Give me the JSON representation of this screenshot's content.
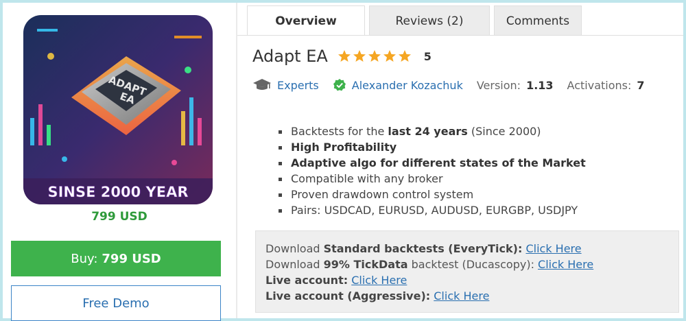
{
  "product": {
    "image_text_line1": "ADAPT",
    "image_text_line2": "EA",
    "image_banner": "SINSE 2000 YEAR",
    "price": "799 USD",
    "buy_label": "Buy:",
    "buy_price": "799 USD",
    "demo_label": "Free Demo"
  },
  "tabs": [
    {
      "label": "Overview",
      "active": true
    },
    {
      "label": "Reviews (2)",
      "active": false
    },
    {
      "label": "Comments",
      "active": false
    }
  ],
  "header": {
    "title": "Adapt EA",
    "stars": 5,
    "rating": "5",
    "star_color": "#f5a623"
  },
  "meta": {
    "category": "Experts",
    "author": "Alexander Kozachuk",
    "version_label": "Version:",
    "version_value": "1.13",
    "activations_label": "Activations:",
    "activations_value": "7"
  },
  "features": [
    {
      "pre": "Backtests for the ",
      "bold": "last 24 years",
      "post": " (Since 2000)"
    },
    {
      "pre": "",
      "bold": "High Profitability",
      "post": ""
    },
    {
      "pre": "",
      "bold": "Adaptive algo for different states of the Market",
      "post": ""
    },
    {
      "pre": "Compatible with any broker",
      "bold": "",
      "post": ""
    },
    {
      "pre": "Proven drawdown control system",
      "bold": "",
      "post": ""
    },
    {
      "pre": "Pairs: USDCAD, EURUSD, AUDUSD, EURGBP, USDJPY",
      "bold": "",
      "post": ""
    }
  ],
  "downloads": [
    {
      "pre": "Download ",
      "bold": "Standard backtests (EveryTick):",
      "mid": "",
      "link": "Click Here"
    },
    {
      "pre": "Download ",
      "bold": "99% TickData",
      "mid": " backtest (Ducascopy):",
      "link": "Click Here"
    },
    {
      "pre": "",
      "bold": "Live account:",
      "mid": "",
      "link": "Click Here"
    },
    {
      "pre": "",
      "bold": "Live account (Aggressive):",
      "mid": "",
      "link": "Click Here"
    }
  ],
  "colors": {
    "buy": "#3eb24c",
    "price": "#2e9a3a",
    "link": "#2a6fb0",
    "verified": "#3eb24c"
  },
  "icons": {
    "category": "graduation-cap-icon",
    "author": "verified-check-icon",
    "star": "star-icon"
  }
}
